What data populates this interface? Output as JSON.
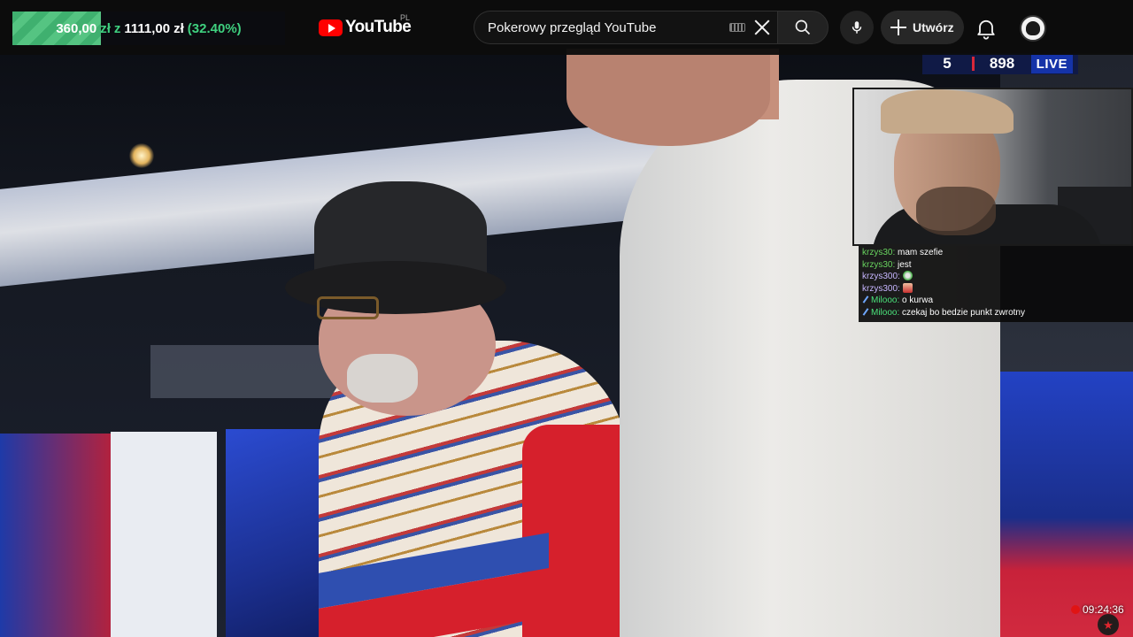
{
  "donation": {
    "current": "360,00",
    "currency": "zł",
    "separator": "z",
    "goal": "1111,00",
    "goal_currency": "zł",
    "percent_label": "(32.40%)",
    "progress": 0.324
  },
  "header": {
    "logo_text": "YouTube",
    "country_code": "PL",
    "search_value": "Pokerowy przegląd YouTube",
    "create_label": "Utwórz"
  },
  "video": {
    "score_left": "5",
    "score_right": "898",
    "live_label": "LIVE"
  },
  "chat": {
    "messages": [
      {
        "user": "krzys30:",
        "text": "mam szefie"
      },
      {
        "user": "krzys30:",
        "text": "jest"
      },
      {
        "user": "krzys300:",
        "text": ""
      },
      {
        "user": "krzys300:",
        "text": ""
      },
      {
        "user": "Milooo:",
        "text": "o kurwa"
      },
      {
        "user": "Milooo:",
        "text": "czekaj bo bedzie punkt zwrotny"
      }
    ]
  },
  "overlay": {
    "clock": "09:24:36"
  },
  "icons": {
    "search": "search-icon",
    "mic": "microphone-icon",
    "bell": "bell-icon",
    "keyboard": "keyboard-icon",
    "clear": "close-icon"
  },
  "colors": {
    "accent_green": "#3fd07f",
    "youtube_red": "#ff0000"
  }
}
